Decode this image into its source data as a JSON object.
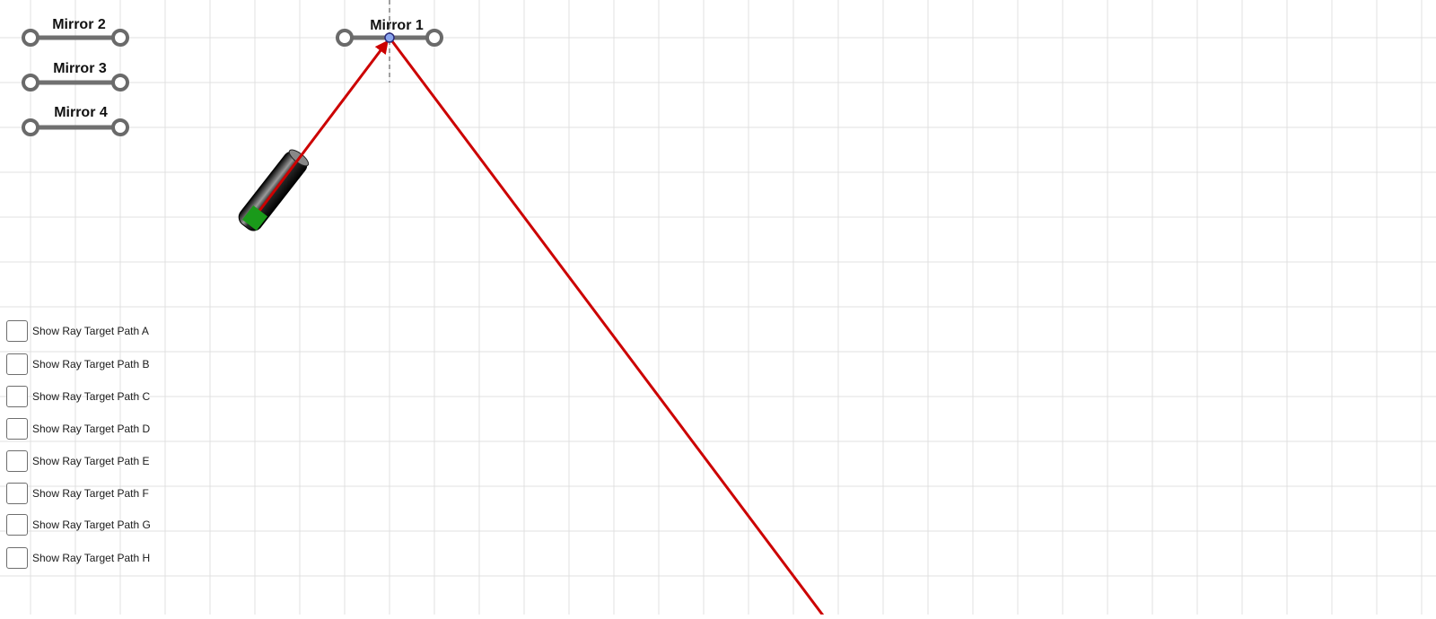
{
  "mirrors": [
    {
      "id": "mirror-1",
      "label": "Mirror 1"
    },
    {
      "id": "mirror-2",
      "label": "Mirror 2"
    },
    {
      "id": "mirror-3",
      "label": "Mirror 3"
    },
    {
      "id": "mirror-4",
      "label": "Mirror 4"
    }
  ],
  "checkboxes": [
    {
      "label": "Show Ray Target Path A",
      "checked": false
    },
    {
      "label": "Show Ray Target Path B",
      "checked": false
    },
    {
      "label": "Show Ray Target Path C",
      "checked": false
    },
    {
      "label": "Show Ray Target Path D",
      "checked": false
    },
    {
      "label": "Show Ray Target Path E",
      "checked": false
    },
    {
      "label": "Show Ray Target Path F",
      "checked": false
    },
    {
      "label": "Show Ray Target Path G",
      "checked": false
    },
    {
      "label": "Show Ray Target Path H",
      "checked": false
    }
  ],
  "icons": {
    "laser": "laser-pointer-icon",
    "mirror_handle": "mirror-handle-icon",
    "hit_point": "reflection-point-icon"
  },
  "colors": {
    "ray": "#cc0000",
    "grid": "#e0e0e0",
    "mirror": "#707070",
    "laser_body": "#111111",
    "laser_tip": "#1a9a1a",
    "hit_point": "#8aa6f0",
    "normal_line": "#a0a0a0"
  }
}
